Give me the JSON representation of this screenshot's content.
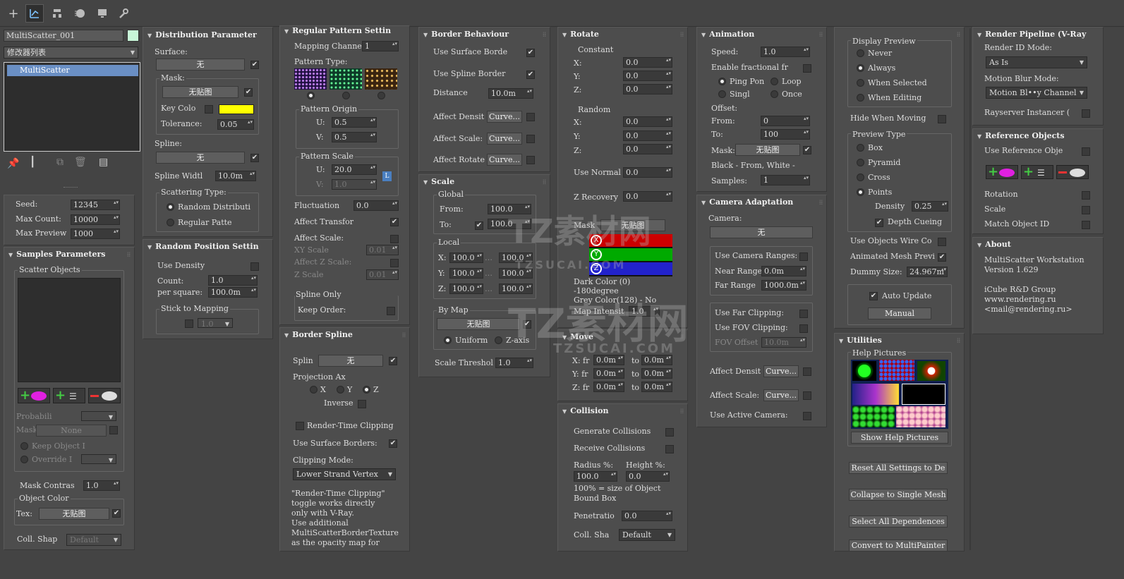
{
  "toolbar": {
    "icons": [
      "create-plus-icon",
      "modify-icon",
      "hierarchy-icon",
      "motion-icon",
      "display-icon",
      "utilities-wrench-icon"
    ]
  },
  "left": {
    "object_name": "MultiScatter_001",
    "modifier_list": "修改器列表",
    "stack_item": "MultiScatter",
    "seed_label": "Seed:",
    "seed": "12345",
    "max_count_label": "Max Count:",
    "max_count": "10000",
    "max_preview_label": "Max Preview",
    "max_preview": "1000"
  },
  "samples": {
    "title": "Samples Parameters",
    "scatter_objects": "Scatter Objects",
    "probability": "Probabili",
    "mask": "Mask",
    "mask_btn": "None",
    "keep_object": "Keep Object I",
    "override": "Override I",
    "mask_contrast_label": "Mask Contras",
    "mask_contrast": "1.0",
    "object_color": "Object Color",
    "tex": "Tex:",
    "tex_btn": "无贴图",
    "coll_shape": "Coll. Shap",
    "coll_shape_val": "Default"
  },
  "distribution": {
    "title": "Distribution Parameter",
    "surface": "Surface:",
    "surface_btn": "无",
    "mask": "Mask:",
    "mask_btn": "无贴图",
    "key_color": "Key Colo",
    "tolerance": "Tolerance:",
    "tolerance_val": "0.05",
    "spline": "Spline:",
    "spline_btn": "无",
    "spline_width": "Spline Widtl",
    "spline_width_val": "10.0m",
    "scattering_type": "Scattering Type:",
    "random_dist": "Random Distributi",
    "regular_pattern": "Regular Patte"
  },
  "random_pos": {
    "title": "Random Position Settin",
    "use_density": "Use Density",
    "count": "Count:",
    "count_val": "1.0",
    "per_square": "per square:",
    "per_square_val": "100.0m",
    "stick": "Stick to Mapping",
    "stick_val": "1.0"
  },
  "regular": {
    "title": "Regular Pattern Settin",
    "mapping_channel": "Mapping Channel",
    "mapping_channel_val": "1",
    "pattern_type": "Pattern Type:",
    "pattern_origin": "Pattern Origin",
    "u": "U:",
    "v": "V:",
    "origin_u": "0.5",
    "origin_v": "0.5",
    "pattern_scale": "Pattern Scale",
    "scale_u": "20.0",
    "scale_v": "1.0",
    "lock": "L",
    "fluctuation": "Fluctuation",
    "fluctuation_val": "0.0",
    "affect_transform": "Affect Transfor",
    "affect_scale": "Affect Scale:",
    "xy_scale": "XY Scale",
    "xy_scale_val": "0.01",
    "affect_z_scale": "Affect Z Scale:",
    "z_scale": "Z Scale",
    "z_scale_val": "0.01",
    "spline_only": "Spline Only",
    "keep_order": "Keep Order:"
  },
  "border_spline": {
    "title": "Border Spline",
    "splin": "Splin",
    "splin_btn": "无",
    "projection_axis": "Projection Ax",
    "x": "X",
    "y": "Y",
    "z": "Z",
    "inverse": "Inverse",
    "render_time_clipping": "Render-Time Clipping",
    "use_surface_borders": "Use Surface Borders:",
    "clipping_mode": "Clipping Mode:",
    "clipping_mode_val": "Lower Strand Vertex",
    "note": [
      "\"Render-Time Clipping\"",
      "toggle works directly",
      "only with V-Ray.",
      "Use additional",
      "MultiScatterBorderTexture",
      "as the opacity map for"
    ]
  },
  "border_behaviour": {
    "title": "Border Behaviour",
    "use_surface_border": "Use Surface Borde",
    "use_spline_border": "Use Spline Border",
    "distance": "Distance",
    "distance_val": "10.0m",
    "affect_density": "Affect Densit",
    "affect_scale": "Affect Scale:",
    "affect_rotate": "Affect Rotate",
    "curve": "Curve..."
  },
  "scale": {
    "title": "Scale",
    "global": "Global",
    "from": "From:",
    "from_val": "100.0",
    "to": "To:",
    "to_val": "100.0",
    "local": "Local",
    "x": "X:",
    "y": "Y:",
    "z": "Z:",
    "lx1": "100.0",
    "lx2": "100.0",
    "ly1": "100.0",
    "ly2": "100.0",
    "lz1": "100.0",
    "lz2": "100.0",
    "by_map": "By Map",
    "by_map_btn": "无贴图",
    "uniform": "Uniform",
    "z_axis": "Z-axis",
    "scale_threshold": "Scale Threshol",
    "scale_threshold_val": "1.0"
  },
  "rotate": {
    "title": "Rotate",
    "constant": "Constant",
    "x": "X:",
    "y": "Y:",
    "z": "Z:",
    "cx": "0.0",
    "cy": "0.0",
    "cz": "0.0",
    "random": "Random",
    "rx": "0.0",
    "ry": "0.0",
    "rz": "0.0",
    "use_normal": "Use Normal",
    "use_normal_val": "0.0",
    "z_recovery": "Z Recovery",
    "z_recovery_val": "0.0",
    "mask": "Mask",
    "mask_btn": "无贴图",
    "dark_color": "Dark Color (0)",
    "minus_180": "-180degree",
    "grey_color": "Grey Color(128) - No",
    "map_intensity": "Map Intensit",
    "map_intensity_val": "1.0",
    "axis_x": "X",
    "axis_y": "Y",
    "axis_z": "Z"
  },
  "move": {
    "title": "Move",
    "x": "X: fr",
    "y": "Y: fr",
    "z": "Z: fr",
    "to": "to",
    "x1": "0.0m",
    "x2": "0.0m",
    "y1": "0.0m",
    "y2": "0.0m",
    "z1": "0.0m",
    "z2": "0.0m"
  },
  "collision": {
    "title": "Collision",
    "generate": "Generate Collisions",
    "receive": "Receive Collisions",
    "radius": "Radius %:",
    "height": "Height %:",
    "radius_val": "100.0",
    "height_val": "0.0",
    "note1": "100% = size of Object",
    "note2": "Bound  Box",
    "penetration": "Penetratio",
    "penetration_val": "0.0",
    "coll_shape": "Coll. Sha",
    "coll_shape_val": "Default"
  },
  "animation": {
    "title": "Animation",
    "speed": "Speed:",
    "speed_val": "1.0",
    "enable_fractional": "Enable fractional fr",
    "ping_pong": "Ping Pon",
    "loop": "Loop",
    "single": "Singl",
    "once": "Once",
    "offset": "Offset:",
    "from": "From:",
    "from_val": "0",
    "to": "To:",
    "to_val": "100",
    "mask": "Mask:",
    "mask_btn": "无贴图",
    "black_white": "Black - From,  White -",
    "samples": "Samples:",
    "samples_val": "1"
  },
  "camera": {
    "title": "Camera Adaptation",
    "camera": "Camera:",
    "camera_btn": "无",
    "use_ranges": "Use Camera Ranges:",
    "near_range": "Near Range:",
    "near_val": "0.0m",
    "far_range": "Far Range",
    "far_val": "1000.0m",
    "use_far_clipping": "Use Far Clipping:",
    "use_fov_clipping": "Use FOV Clipping:",
    "fov_offset": "FOV Offset",
    "fov_val": "10.0m",
    "affect_density": "Affect Densit",
    "affect_scale": "Affect Scale:",
    "curve": "Curve...",
    "use_active": "Use Active Camera:"
  },
  "display": {
    "display_preview": "Display Preview",
    "never": "Never",
    "always": "Always",
    "when_selected": "When Selected",
    "when_editing": "When Editing",
    "hide_when_moving": "Hide When Moving",
    "preview_type": "Preview Type",
    "box": "Box",
    "pyramid": "Pyramid",
    "cross": "Cross",
    "points": "Points",
    "density": "Density",
    "density_val": "0.25",
    "depth_cueing": "Depth Cueing",
    "use_objects_wire": "Use Objects Wire Co",
    "animated_mesh": "Animated Mesh Previ",
    "dummy_size": "Dummy Size:",
    "dummy_val": "24.967m",
    "auto_update": "Auto Update",
    "manual": "Manual"
  },
  "utilities": {
    "title": "Utilities",
    "help_pictures": "Help Pictures",
    "show_help": "Show Help Pictures",
    "reset_all": "Reset All Settings to De",
    "collapse": "Collapse to Single Mesh",
    "select_all": "Select All Dependences",
    "convert": "Convert to MultiPainter"
  },
  "render_pipeline": {
    "title": "Render Pipeline (V-Ray",
    "render_id_mode": "Render ID Mode:",
    "render_id_val": "As Is",
    "motion_blur": "Motion Blur Mode:",
    "motion_blur_val": "Motion Bl••y Channel",
    "rayserver": "Rayserver Instancer ("
  },
  "reference": {
    "title": "Reference Objects",
    "use_reference": "Use Reference Obje",
    "rotation": "Rotation",
    "scale": "Scale",
    "match_id": "Match Object ID"
  },
  "about": {
    "title": "About",
    "line1": "MultiScatter Workstation",
    "line2": "Version 1.629",
    "line3": "iCube R&D Group",
    "line4": "www.rendering.ru",
    "line5": "<mail@rendering.ru>"
  },
  "watermark": {
    "brand": "TZ素材网",
    "url": "TZSUCAI.COM"
  },
  "colors": {
    "panel": "#4d4d4d",
    "key_color": "#ffff00",
    "object_color_swatch": "#c8f5d8"
  }
}
